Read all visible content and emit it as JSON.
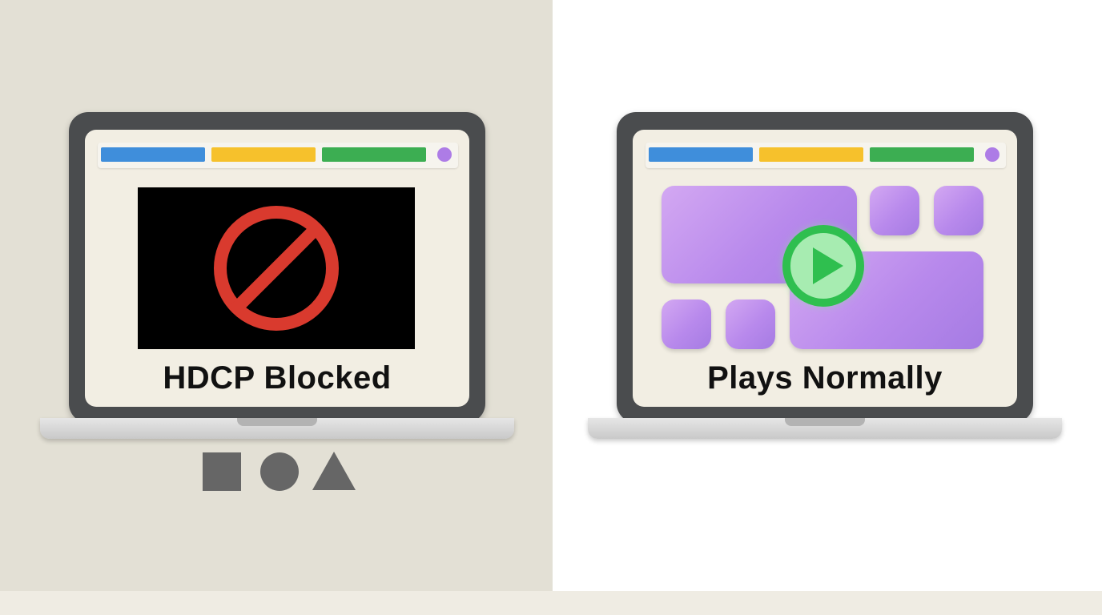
{
  "panels": {
    "left": {
      "caption": "HDCP Blocked",
      "content_icon": "prohibited-icon",
      "colors": {
        "background": "#e3e0d5",
        "video_background": "#000000",
        "prohibited": "#d93a2e"
      }
    },
    "right": {
      "caption": "Plays Normally",
      "content_icon": "play-icon",
      "colors": {
        "background": "#ffffff",
        "tiles": "#b98aec",
        "play": "#2fbf4f"
      }
    }
  },
  "toolbar": {
    "tab_colors": [
      "#3f8edb",
      "#f6c12c",
      "#3cae52"
    ],
    "dot_color": "#ad7ce6"
  },
  "legend_shapes": [
    "square-icon",
    "circle-icon",
    "triangle-icon"
  ]
}
